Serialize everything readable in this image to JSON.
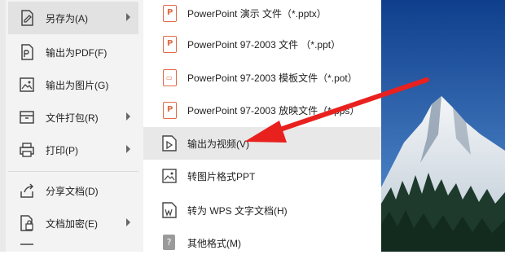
{
  "left_menu": {
    "items": [
      {
        "label": "另存为(A)",
        "icon": "save-as-icon",
        "has_submenu": true,
        "active": true
      },
      {
        "label": "输出为PDF(F)",
        "icon": "pdf-export-icon",
        "has_submenu": false
      },
      {
        "label": "输出为图片(G)",
        "icon": "image-export-icon",
        "has_submenu": false
      },
      {
        "label": "文件打包(R)",
        "icon": "package-icon",
        "has_submenu": true
      },
      {
        "label": "打印(P)",
        "icon": "printer-icon",
        "has_submenu": true
      },
      {
        "label": "分享文档(D)",
        "icon": "share-icon",
        "has_submenu": false
      },
      {
        "label": "文档加密(E)",
        "icon": "lock-document-icon",
        "has_submenu": true
      }
    ]
  },
  "submenu": {
    "items": [
      {
        "label": "PowerPoint 演示 文件（*.pptx）",
        "icon": "pptx-file-icon"
      },
      {
        "label": "PowerPoint 97-2003 文件 （*.ppt）",
        "icon": "ppt-file-icon"
      },
      {
        "label": "PowerPoint 97-2003 模板文件（*.pot）",
        "icon": "pot-file-icon"
      },
      {
        "label": "PowerPoint 97-2003 放映文件（*.pps）",
        "icon": "pps-file-icon"
      },
      {
        "label": "输出为视频(V)",
        "icon": "video-export-icon",
        "active": true
      },
      {
        "label": "转图片格式PPT",
        "icon": "picture-ppt-icon"
      },
      {
        "label": "转为 WPS 文字文档(H)",
        "icon": "wps-doc-icon"
      },
      {
        "label": "其他格式(M)",
        "icon": "other-format-icon"
      }
    ]
  },
  "annotation": {
    "arrow_color": "#e8211f"
  },
  "colors": {
    "accent_ppt": "#e06b45",
    "highlight": "#e8e8e8"
  }
}
